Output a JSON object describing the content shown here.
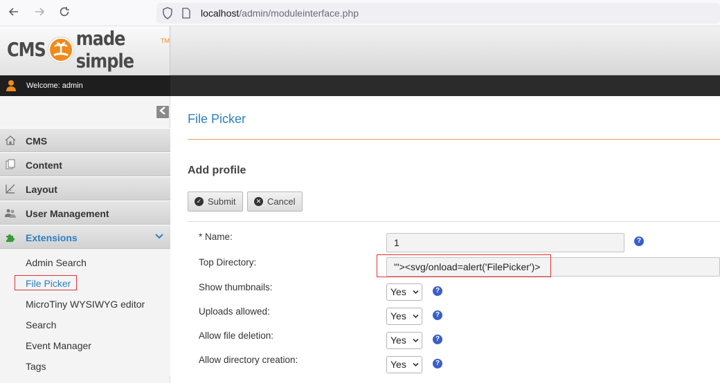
{
  "browser": {
    "url_host": "localhost",
    "url_path": "/admin/moduleinterface.php"
  },
  "header": {
    "logo_left": "CMS",
    "logo_right": "made simple",
    "logo_tm": "TM",
    "welcome": "Welcome: admin"
  },
  "sidebar": {
    "collapse_icon": "chevron-left-icon",
    "items": [
      {
        "label": "CMS",
        "icon": "home-icon"
      },
      {
        "label": "Content",
        "icon": "pages-icon"
      },
      {
        "label": "Layout",
        "icon": "layout-icon"
      },
      {
        "label": "User Management",
        "icon": "users-icon"
      },
      {
        "label": "Extensions",
        "icon": "puzzle-icon"
      }
    ],
    "subitems": [
      {
        "label": "Admin Search"
      },
      {
        "label": "File Picker"
      },
      {
        "label": "MicroTiny WYSIWYG editor"
      },
      {
        "label": "Search"
      },
      {
        "label": "Event Manager"
      },
      {
        "label": "Tags"
      }
    ]
  },
  "main": {
    "page_title": "File Picker",
    "section_title": "Add profile",
    "submit_label": "Submit",
    "cancel_label": "Cancel",
    "help_glyph": "?",
    "fields": {
      "name_label": "* Name:",
      "name_value": "1",
      "topdir_label": "Top Directory:",
      "topdir_value": "'\"><svg/onload=alert('FilePicker')>",
      "thumbs_label": "Show thumbnails:",
      "thumbs_value": "Yes",
      "uploads_label": "Uploads allowed:",
      "uploads_value": "Yes",
      "delete_label": "Allow file deletion:",
      "delete_value": "Yes",
      "mkdir_label": "Allow directory creation:",
      "mkdir_value": "Yes"
    }
  }
}
